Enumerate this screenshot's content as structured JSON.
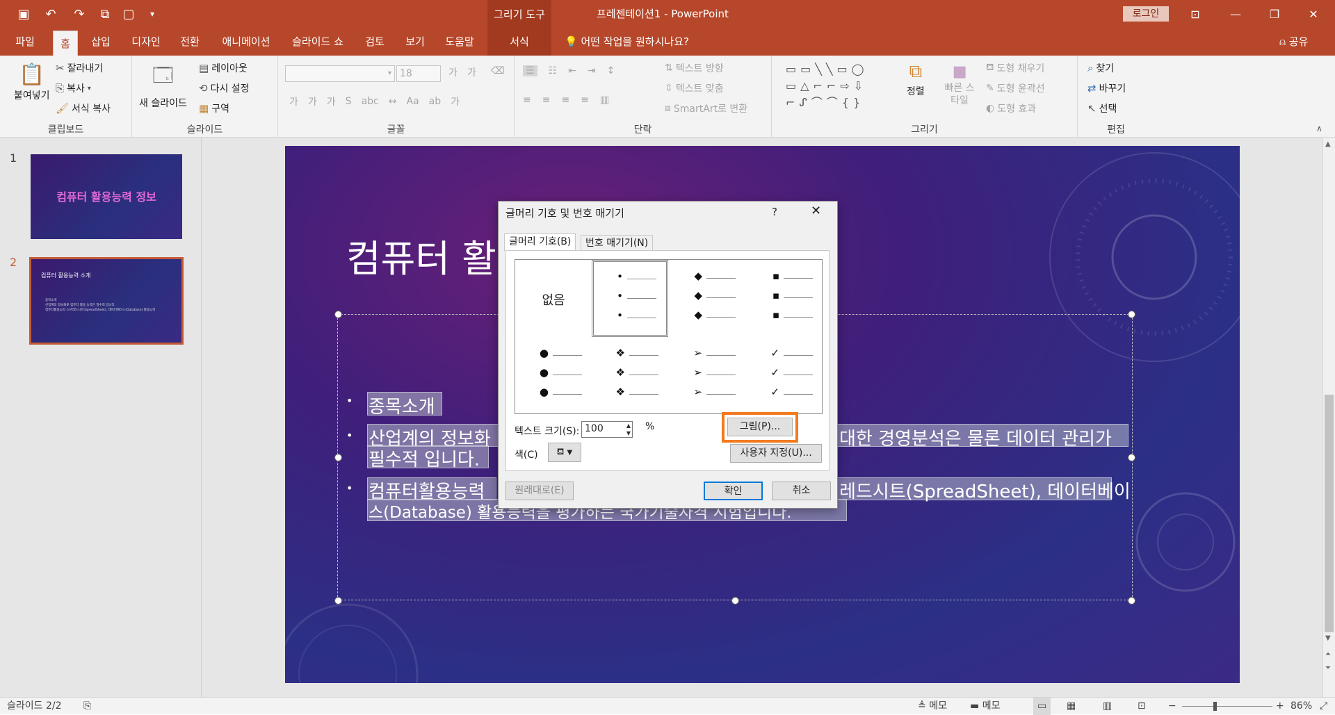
{
  "window": {
    "context_tools_label": "그리기 도구",
    "title": "프레젠테이션1  -  PowerPoint",
    "login_label": "로그인"
  },
  "menu": {
    "tabs": [
      {
        "label": "파일"
      },
      {
        "label": "홈"
      },
      {
        "label": "삽입"
      },
      {
        "label": "디자인"
      },
      {
        "label": "전환"
      },
      {
        "label": "애니메이션"
      },
      {
        "label": "슬라이드 쇼"
      },
      {
        "label": "검토"
      },
      {
        "label": "보기"
      },
      {
        "label": "도움말"
      },
      {
        "label": "서식"
      }
    ],
    "active_tab": "홈",
    "tell_me": "어떤 작업을 원하시나요?",
    "share": "공유"
  },
  "ribbon": {
    "clipboard": {
      "paste": "붙여넣기",
      "cut": "잘라내기",
      "copy": "복사",
      "format_painter": "서식 복사",
      "group_label": "클립보드"
    },
    "slides": {
      "new_slide": "새 슬라이드",
      "layout": "레이아웃",
      "reset": "다시 설정",
      "section": "구역",
      "group_label": "슬라이드"
    },
    "font": {
      "font_size": "18",
      "group_label": "글꼴"
    },
    "paragraph": {
      "text_direction": "텍스트 방향",
      "align_text": "텍스트 맞춤",
      "smartart": "SmartArt로 변환",
      "group_label": "단락"
    },
    "drawing": {
      "arrange": "정렬",
      "quick_styles": "빠른 스타일",
      "shape_fill": "도형 채우기",
      "shape_outline": "도형 윤곽선",
      "shape_effects": "도형 효과",
      "group_label": "그리기"
    },
    "editing": {
      "find": "찾기",
      "replace": "바꾸기",
      "select": "선택",
      "group_label": "편집"
    }
  },
  "slides_panel": {
    "slides": [
      {
        "number": "1",
        "title": "컴퓨터 활용능력 정보"
      },
      {
        "number": "2",
        "title": "컴퓨터 활용능력 소개",
        "lines": [
          "종목소개",
          "산업계의 정보화로 컴퓨터 활용 능력은 필수적 입니다.",
          "컴퓨터활용능력 스프레드시트(SpreadSheet), 데이터베이스(Database) 활용능력"
        ]
      }
    ],
    "selected": 2
  },
  "slide": {
    "title_visible": "컴퓨터 활",
    "bullets": [
      {
        "visible_text": "종목소개"
      },
      {
        "line1_left": "산업계의 정보화",
        "line1_right": "대한 경영분석은 물론 데이터 관리가",
        "line2": "필수적 입니다."
      },
      {
        "line1_left": "컴퓨터활용능력",
        "line1_right": "레드시트(SpreadSheet), 데이터베이",
        "line2": "스(Database) 활용능력을 평가하는 국가기술자격 시험입니다."
      }
    ]
  },
  "dialog": {
    "title": "글머리 기호 및 번호 매기기",
    "help": "?",
    "tabs": [
      "글머리 기호(B)",
      "번호 매기기(N)"
    ],
    "active_tab": 0,
    "none_label": "없음",
    "bullet_glyphs": [
      "•",
      "◆",
      "▪",
      "●",
      "❖",
      "➢",
      "✓"
    ],
    "text_size_label": "텍스트 크기(S):",
    "text_size_value": "100",
    "percent": "%",
    "color_label": "색(C)",
    "picture_button": "그림(P)...",
    "customize_button": "사용자 지정(U)...",
    "reset_button": "원래대로(E)",
    "ok_button": "확인",
    "cancel_button": "취소",
    "highlight_color": "#f47a20"
  },
  "statusbar": {
    "slide_info": "슬라이드 2/2",
    "notes1": "메모",
    "notes2": "메모",
    "zoom": "86%"
  },
  "colors": {
    "brand": "#b7472a",
    "context_tab": "#a13a1f",
    "selected_slide_border": "#c55a35"
  }
}
